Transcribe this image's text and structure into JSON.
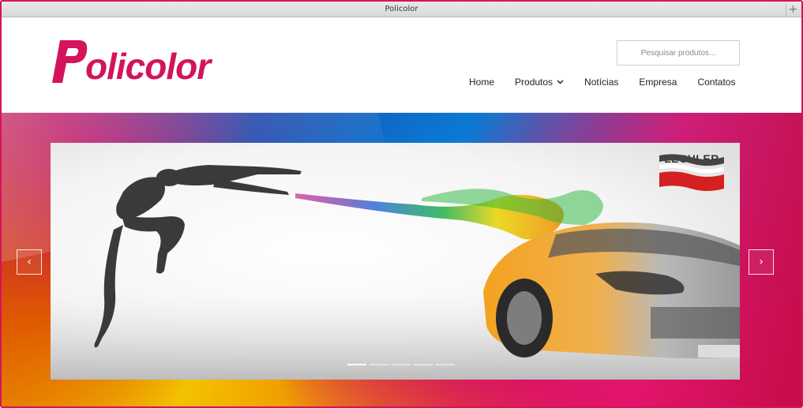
{
  "window": {
    "title": "Policolor",
    "new_tab_symbol": "+"
  },
  "header": {
    "logo_text": "olicolor",
    "search": {
      "placeholder": "Pesquisar produtos...",
      "value": ""
    },
    "nav": [
      {
        "label": "Home"
      },
      {
        "label": "Produtos",
        "has_dropdown": true
      },
      {
        "label": "Notícias"
      },
      {
        "label": "Empresa"
      },
      {
        "label": "Contatos"
      }
    ]
  },
  "slider": {
    "brand": "LECHLER",
    "prev_symbol": "‹",
    "next_symbol": "›",
    "active_slide": 0,
    "slide_count": 5
  },
  "colors": {
    "brand": "#d4145a",
    "text": "#222222"
  },
  "icons": [
    "plus-icon",
    "chevron-down-icon",
    "chevron-left-icon",
    "chevron-right-icon"
  ]
}
